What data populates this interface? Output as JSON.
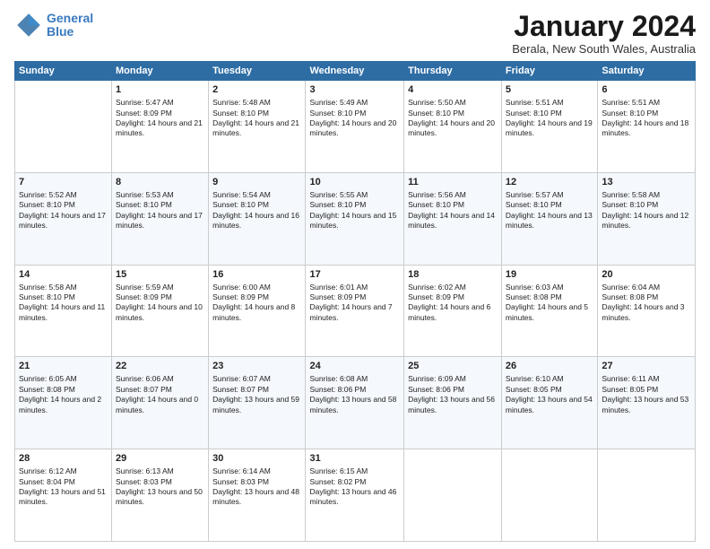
{
  "logo": {
    "line1": "General",
    "line2": "Blue"
  },
  "title": "January 2024",
  "subtitle": "Berala, New South Wales, Australia",
  "days_of_week": [
    "Sunday",
    "Monday",
    "Tuesday",
    "Wednesday",
    "Thursday",
    "Friday",
    "Saturday"
  ],
  "weeks": [
    [
      {
        "day": "",
        "sunrise": "",
        "sunset": "",
        "daylight": ""
      },
      {
        "day": "1",
        "sunrise": "Sunrise: 5:47 AM",
        "sunset": "Sunset: 8:09 PM",
        "daylight": "Daylight: 14 hours and 21 minutes."
      },
      {
        "day": "2",
        "sunrise": "Sunrise: 5:48 AM",
        "sunset": "Sunset: 8:10 PM",
        "daylight": "Daylight: 14 hours and 21 minutes."
      },
      {
        "day": "3",
        "sunrise": "Sunrise: 5:49 AM",
        "sunset": "Sunset: 8:10 PM",
        "daylight": "Daylight: 14 hours and 20 minutes."
      },
      {
        "day": "4",
        "sunrise": "Sunrise: 5:50 AM",
        "sunset": "Sunset: 8:10 PM",
        "daylight": "Daylight: 14 hours and 20 minutes."
      },
      {
        "day": "5",
        "sunrise": "Sunrise: 5:51 AM",
        "sunset": "Sunset: 8:10 PM",
        "daylight": "Daylight: 14 hours and 19 minutes."
      },
      {
        "day": "6",
        "sunrise": "Sunrise: 5:51 AM",
        "sunset": "Sunset: 8:10 PM",
        "daylight": "Daylight: 14 hours and 18 minutes."
      }
    ],
    [
      {
        "day": "7",
        "sunrise": "Sunrise: 5:52 AM",
        "sunset": "Sunset: 8:10 PM",
        "daylight": "Daylight: 14 hours and 17 minutes."
      },
      {
        "day": "8",
        "sunrise": "Sunrise: 5:53 AM",
        "sunset": "Sunset: 8:10 PM",
        "daylight": "Daylight: 14 hours and 17 minutes."
      },
      {
        "day": "9",
        "sunrise": "Sunrise: 5:54 AM",
        "sunset": "Sunset: 8:10 PM",
        "daylight": "Daylight: 14 hours and 16 minutes."
      },
      {
        "day": "10",
        "sunrise": "Sunrise: 5:55 AM",
        "sunset": "Sunset: 8:10 PM",
        "daylight": "Daylight: 14 hours and 15 minutes."
      },
      {
        "day": "11",
        "sunrise": "Sunrise: 5:56 AM",
        "sunset": "Sunset: 8:10 PM",
        "daylight": "Daylight: 14 hours and 14 minutes."
      },
      {
        "day": "12",
        "sunrise": "Sunrise: 5:57 AM",
        "sunset": "Sunset: 8:10 PM",
        "daylight": "Daylight: 14 hours and 13 minutes."
      },
      {
        "day": "13",
        "sunrise": "Sunrise: 5:58 AM",
        "sunset": "Sunset: 8:10 PM",
        "daylight": "Daylight: 14 hours and 12 minutes."
      }
    ],
    [
      {
        "day": "14",
        "sunrise": "Sunrise: 5:58 AM",
        "sunset": "Sunset: 8:10 PM",
        "daylight": "Daylight: 14 hours and 11 minutes."
      },
      {
        "day": "15",
        "sunrise": "Sunrise: 5:59 AM",
        "sunset": "Sunset: 8:09 PM",
        "daylight": "Daylight: 14 hours and 10 minutes."
      },
      {
        "day": "16",
        "sunrise": "Sunrise: 6:00 AM",
        "sunset": "Sunset: 8:09 PM",
        "daylight": "Daylight: 14 hours and 8 minutes."
      },
      {
        "day": "17",
        "sunrise": "Sunrise: 6:01 AM",
        "sunset": "Sunset: 8:09 PM",
        "daylight": "Daylight: 14 hours and 7 minutes."
      },
      {
        "day": "18",
        "sunrise": "Sunrise: 6:02 AM",
        "sunset": "Sunset: 8:09 PM",
        "daylight": "Daylight: 14 hours and 6 minutes."
      },
      {
        "day": "19",
        "sunrise": "Sunrise: 6:03 AM",
        "sunset": "Sunset: 8:08 PM",
        "daylight": "Daylight: 14 hours and 5 minutes."
      },
      {
        "day": "20",
        "sunrise": "Sunrise: 6:04 AM",
        "sunset": "Sunset: 8:08 PM",
        "daylight": "Daylight: 14 hours and 3 minutes."
      }
    ],
    [
      {
        "day": "21",
        "sunrise": "Sunrise: 6:05 AM",
        "sunset": "Sunset: 8:08 PM",
        "daylight": "Daylight: 14 hours and 2 minutes."
      },
      {
        "day": "22",
        "sunrise": "Sunrise: 6:06 AM",
        "sunset": "Sunset: 8:07 PM",
        "daylight": "Daylight: 14 hours and 0 minutes."
      },
      {
        "day": "23",
        "sunrise": "Sunrise: 6:07 AM",
        "sunset": "Sunset: 8:07 PM",
        "daylight": "Daylight: 13 hours and 59 minutes."
      },
      {
        "day": "24",
        "sunrise": "Sunrise: 6:08 AM",
        "sunset": "Sunset: 8:06 PM",
        "daylight": "Daylight: 13 hours and 58 minutes."
      },
      {
        "day": "25",
        "sunrise": "Sunrise: 6:09 AM",
        "sunset": "Sunset: 8:06 PM",
        "daylight": "Daylight: 13 hours and 56 minutes."
      },
      {
        "day": "26",
        "sunrise": "Sunrise: 6:10 AM",
        "sunset": "Sunset: 8:05 PM",
        "daylight": "Daylight: 13 hours and 54 minutes."
      },
      {
        "day": "27",
        "sunrise": "Sunrise: 6:11 AM",
        "sunset": "Sunset: 8:05 PM",
        "daylight": "Daylight: 13 hours and 53 minutes."
      }
    ],
    [
      {
        "day": "28",
        "sunrise": "Sunrise: 6:12 AM",
        "sunset": "Sunset: 8:04 PM",
        "daylight": "Daylight: 13 hours and 51 minutes."
      },
      {
        "day": "29",
        "sunrise": "Sunrise: 6:13 AM",
        "sunset": "Sunset: 8:03 PM",
        "daylight": "Daylight: 13 hours and 50 minutes."
      },
      {
        "day": "30",
        "sunrise": "Sunrise: 6:14 AM",
        "sunset": "Sunset: 8:03 PM",
        "daylight": "Daylight: 13 hours and 48 minutes."
      },
      {
        "day": "31",
        "sunrise": "Sunrise: 6:15 AM",
        "sunset": "Sunset: 8:02 PM",
        "daylight": "Daylight: 13 hours and 46 minutes."
      },
      {
        "day": "",
        "sunrise": "",
        "sunset": "",
        "daylight": ""
      },
      {
        "day": "",
        "sunrise": "",
        "sunset": "",
        "daylight": ""
      },
      {
        "day": "",
        "sunrise": "",
        "sunset": "",
        "daylight": ""
      }
    ]
  ]
}
